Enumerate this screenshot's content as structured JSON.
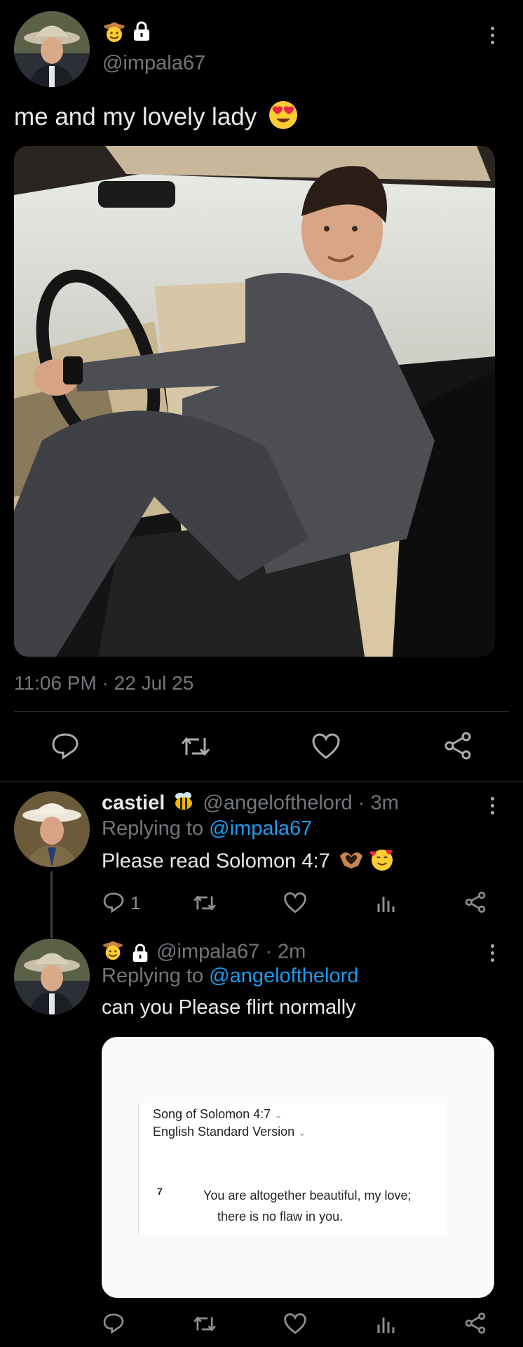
{
  "colors": {
    "background": "#000000",
    "text": "#e7e9ea",
    "muted": "#71767b",
    "link": "#1d9bf0",
    "divider": "#2f3336"
  },
  "main_tweet": {
    "avatar": "cowboy-hat-man-avatar",
    "badges": [
      "cowboy-face-emoji",
      "lock-icon"
    ],
    "handle": "@impala67",
    "text": "me and my lovely lady",
    "emoji": "heart-eyes-emoji",
    "image": "man-sitting-in-classic-car-photo",
    "timestamp": "11:06 PM · 22 Jul 25",
    "actions": [
      "reply-icon",
      "retweet-icon",
      "like-icon",
      "share-icon"
    ]
  },
  "replies": [
    {
      "name": "castiel",
      "name_emoji": "bee-emoji",
      "handle": "@angelofthelord",
      "time": "· 3m",
      "replying_to_label": "Replying to",
      "replying_to": "@impala67",
      "text": "Please read Solomon 4:7",
      "emojis": [
        "heart-hands-emoji",
        "smiling-face-with-hearts-emoji"
      ],
      "reply_count": "1",
      "actions": [
        "reply-icon",
        "retweet-icon",
        "like-icon",
        "views-icon",
        "share-icon"
      ]
    },
    {
      "badges": [
        "cowboy-face-emoji",
        "lock-icon"
      ],
      "handle": "@impala67",
      "time": "· 2m",
      "replying_to_label": "Replying to",
      "replying_to": "@angelofthelord",
      "text": "can you Please flirt normally",
      "attachment": {
        "reference": "Song of Solomon 4:7",
        "version": "English Standard Version",
        "verse_number": "7",
        "verse_line1": "You are altogether beautiful, my love;",
        "verse_line2": "there is no flaw in you."
      },
      "actions": [
        "reply-icon",
        "retweet-icon",
        "like-icon",
        "views-icon",
        "share-icon"
      ]
    }
  ]
}
